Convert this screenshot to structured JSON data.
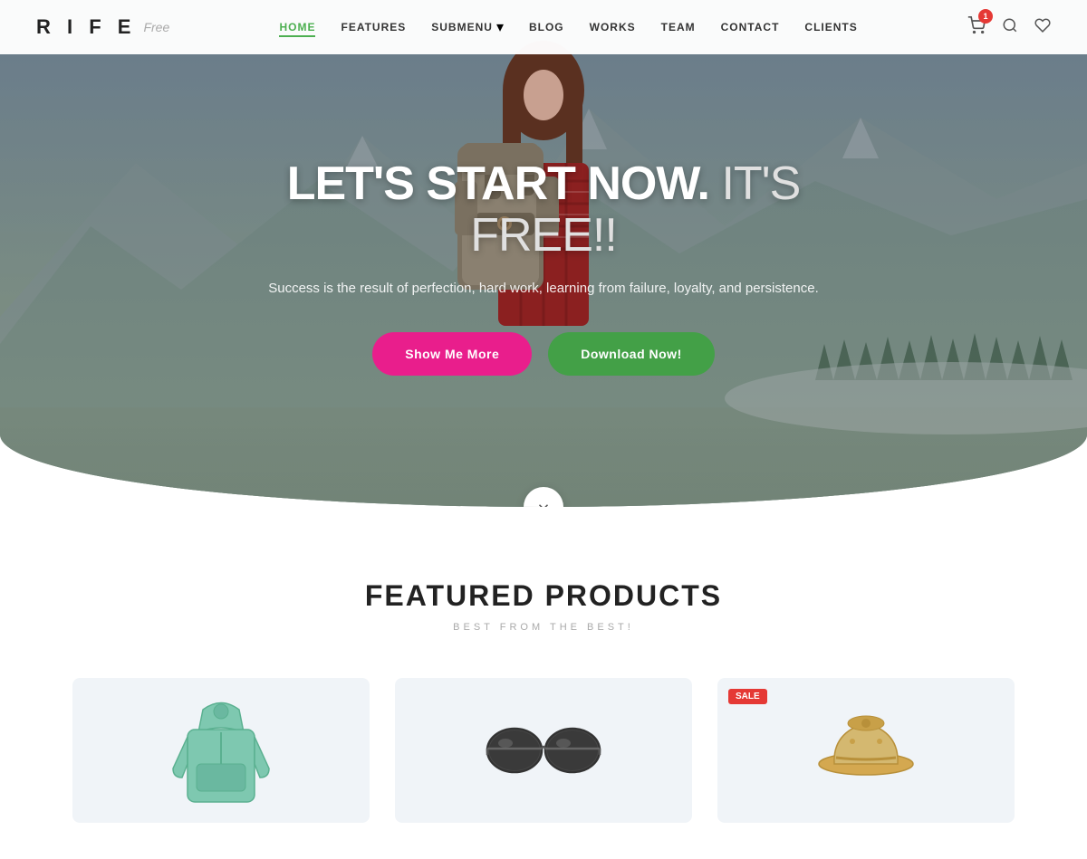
{
  "logo": {
    "rife": "R I F E",
    "free": "Free"
  },
  "nav": {
    "links": [
      {
        "label": "HOME",
        "active": true,
        "id": "home"
      },
      {
        "label": "FEATURES",
        "active": false,
        "id": "features"
      },
      {
        "label": "SUBMENU",
        "active": false,
        "id": "submenu",
        "hasDropdown": true
      },
      {
        "label": "BLOG",
        "active": false,
        "id": "blog"
      },
      {
        "label": "WORKS",
        "active": false,
        "id": "works"
      },
      {
        "label": "TEAM",
        "active": false,
        "id": "team"
      },
      {
        "label": "CONTACT",
        "active": false,
        "id": "contact"
      },
      {
        "label": "CLIENTS",
        "active": false,
        "id": "clients"
      }
    ],
    "cart_count": "1"
  },
  "hero": {
    "heading_main": "LET'S START NOW.",
    "heading_free": " IT'S FREE!!",
    "subtext": "Success is the result of perfection, hard work, learning\nfrom failure, loyalty, and persistence.",
    "btn_show": "Show Me More",
    "btn_download": "Download Now!"
  },
  "products": {
    "title": "FEATURED PRODUCTS",
    "subtitle": "BEST FROM THE BEST!",
    "items": [
      {
        "id": "hoodie",
        "sale": false
      },
      {
        "id": "glasses",
        "sale": false
      },
      {
        "id": "hat",
        "sale": true
      }
    ]
  },
  "icons": {
    "cart": "🛒",
    "search": "🔍",
    "wishlist": "♡",
    "dropdown_arrow": "▾",
    "scroll_down": "↓"
  }
}
